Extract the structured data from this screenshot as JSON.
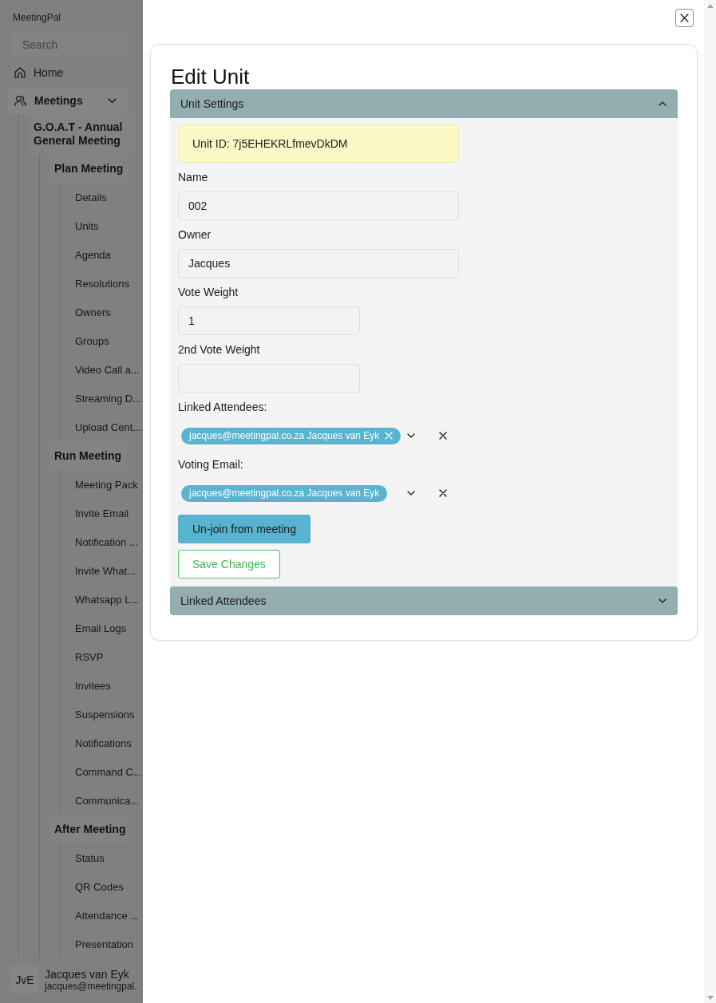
{
  "sidebar": {
    "app_name": "MeetingPal",
    "search": {
      "placeholder": "Search"
    },
    "items": [
      {
        "label": "Home"
      },
      {
        "label": "Meetings",
        "expanded": true,
        "children": [
          {
            "label": "G.O.A.T - Annual General Meeting",
            "children": [
              {
                "label": "Plan Meeting",
                "children": [
                  {
                    "label": "Details"
                  },
                  {
                    "label": "Units"
                  },
                  {
                    "label": "Agenda"
                  },
                  {
                    "label": "Resolutions"
                  },
                  {
                    "label": "Owners"
                  },
                  {
                    "label": "Groups"
                  },
                  {
                    "label": "Video Call a..."
                  },
                  {
                    "label": "Streaming D..."
                  },
                  {
                    "label": "Upload Cent..."
                  }
                ]
              },
              {
                "label": "Run Meeting",
                "children": [
                  {
                    "label": "Meeting Pack"
                  },
                  {
                    "label": "Invite Email"
                  },
                  {
                    "label": "Notification ..."
                  },
                  {
                    "label": "Invite What..."
                  },
                  {
                    "label": "Whatsapp L..."
                  },
                  {
                    "label": "Email Logs"
                  },
                  {
                    "label": "RSVP"
                  },
                  {
                    "label": "Invitees"
                  },
                  {
                    "label": "Suspensions"
                  },
                  {
                    "label": "Notifications"
                  },
                  {
                    "label": "Command C..."
                  },
                  {
                    "label": "Communica..."
                  }
                ]
              },
              {
                "label": "After Meeting",
                "children": [
                  {
                    "label": "Status"
                  },
                  {
                    "label": "QR Codes"
                  },
                  {
                    "label": "Attendance ..."
                  },
                  {
                    "label": "Presentation"
                  }
                ]
              }
            ]
          }
        ]
      }
    ],
    "user": {
      "initials": "JvE",
      "name": "Jacques van Eyk",
      "email": "jacques@meetingpal."
    }
  },
  "dialog": {
    "title": "Edit Unit",
    "sections": [
      {
        "title": "Unit Settings",
        "expanded": true,
        "unit_id": "Unit ID: 7j5EHEKRLfmevDkDM",
        "fields": [
          {
            "kind": "text",
            "label": "Name",
            "value": "002"
          },
          {
            "kind": "text",
            "label": "Owner",
            "value": "Jacques"
          },
          {
            "kind": "number",
            "label": "Vote Weight",
            "value": "1"
          },
          {
            "kind": "number",
            "label": "2nd Vote Weight"
          },
          {
            "kind": "multi-select",
            "label": "Linked Attendees:",
            "chips": [
              "jacques@meetingpal.co.za Jacques van Eyk"
            ]
          },
          {
            "kind": "select",
            "label": "Voting Email:",
            "chips": [
              "jacques@meetingpal.co.za Jacques van Eyk"
            ]
          }
        ],
        "buttons": [
          {
            "kind": "primary",
            "label": "Un-join from meeting"
          },
          {
            "kind": "outline",
            "label": "Save Changes"
          }
        ]
      },
      {
        "title": "Linked Attendees",
        "expanded": false
      }
    ]
  }
}
